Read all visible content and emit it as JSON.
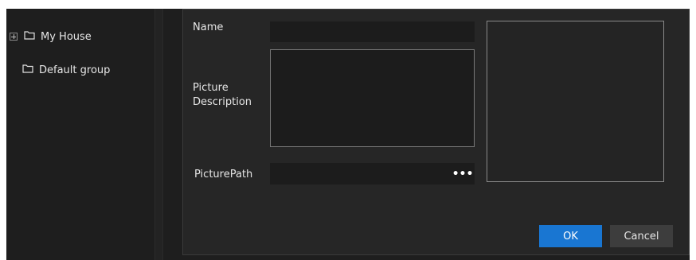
{
  "tree": {
    "items": [
      {
        "label": "My House",
        "expandable": true,
        "icon": "folder-icon"
      },
      {
        "label": "Default group",
        "expandable": false,
        "icon": "folder-icon"
      }
    ]
  },
  "form": {
    "name_label": "Name",
    "name_value": "",
    "description_label": "Picture Description",
    "description_value": "",
    "path_label": "PicturePath",
    "path_value": "",
    "browse_label": "•••"
  },
  "buttons": {
    "ok_label": "OK",
    "cancel_label": "Cancel"
  },
  "colors": {
    "accent": "#1976d2",
    "background": "#1e1e1e",
    "dialog": "#262626"
  }
}
